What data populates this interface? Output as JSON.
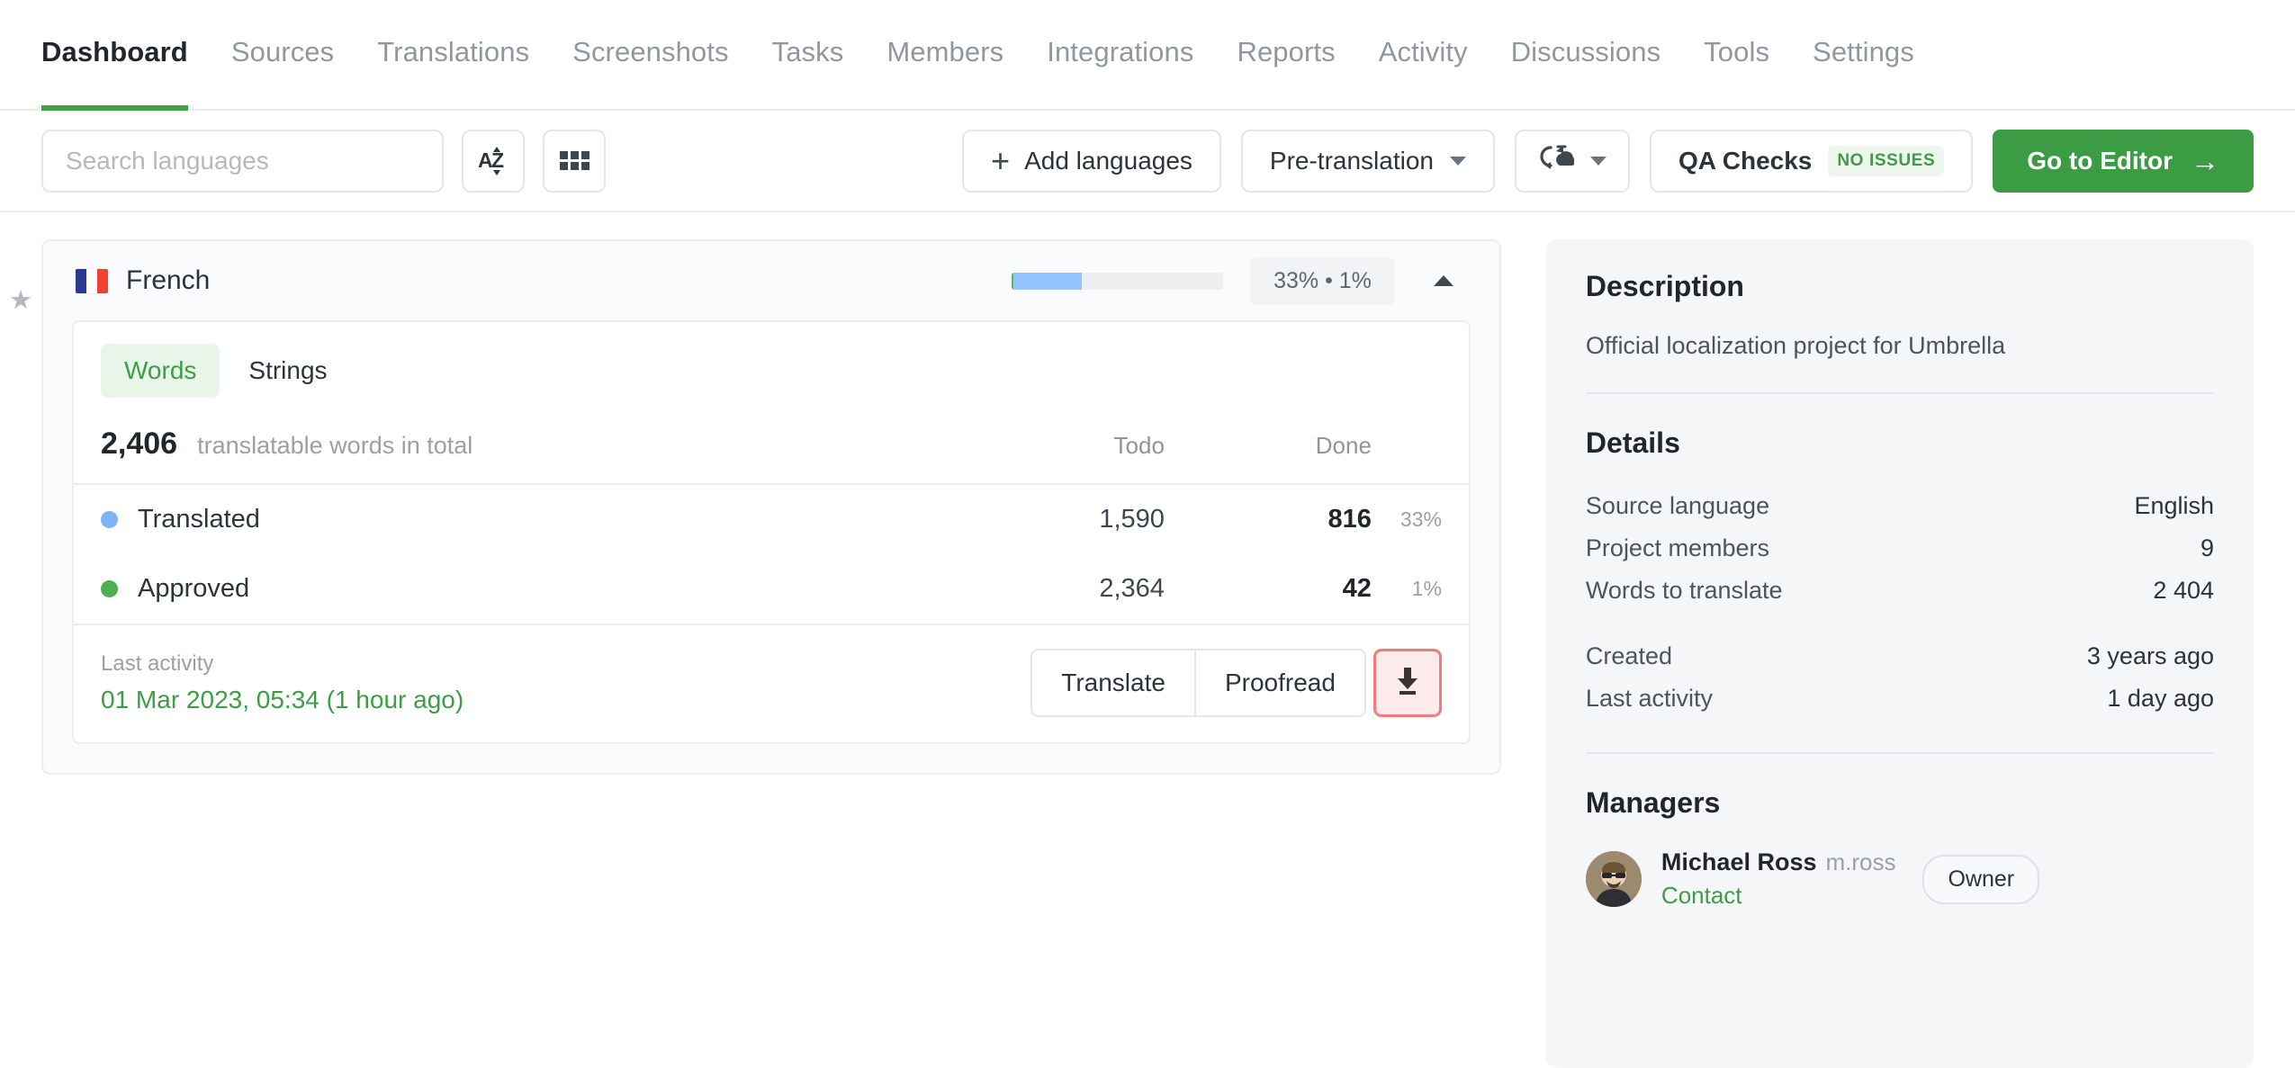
{
  "nav": {
    "items": [
      {
        "label": "Dashboard",
        "active": true
      },
      {
        "label": "Sources",
        "active": false
      },
      {
        "label": "Translations",
        "active": false
      },
      {
        "label": "Screenshots",
        "active": false
      },
      {
        "label": "Tasks",
        "active": false
      },
      {
        "label": "Members",
        "active": false
      },
      {
        "label": "Integrations",
        "active": false
      },
      {
        "label": "Reports",
        "active": false
      },
      {
        "label": "Activity",
        "active": false
      },
      {
        "label": "Discussions",
        "active": false
      },
      {
        "label": "Tools",
        "active": false
      },
      {
        "label": "Settings",
        "active": false
      }
    ]
  },
  "toolbar": {
    "search_placeholder": "Search languages",
    "search_value": "",
    "sort_icon": "sort-alpha-icon",
    "sort_icon_label": "AZ",
    "grid_icon": "grid-view-icon",
    "add_languages_label": "Add languages",
    "add_languages_icon": "plus-icon",
    "pretranslation_label": "Pre-translation",
    "pretranslation_caret": "chevron-down-icon",
    "sync_icon": "sync-cloud-icon",
    "sync_caret": "chevron-down-icon",
    "qa_checks_label": "QA Checks",
    "qa_checks_badge": "NO ISSUES",
    "go_to_editor_label": "Go to Editor",
    "go_to_editor_arrow": "→"
  },
  "language_card": {
    "star_icon": "star-icon",
    "flag_icon": "flag-france-icon",
    "flag_colors": [
      "#2b3a8f",
      "#ffffff",
      "#ef4135"
    ],
    "name": "French",
    "progress": {
      "approved_pct": 1,
      "translated_pct": 33,
      "approved_color": "#5cb85c",
      "translated_color": "#93c5fd",
      "track_color": "#eceef0"
    },
    "pct_badge": "33% • 1%",
    "collapse_icon": "chevron-up-icon",
    "tabs": [
      {
        "label": "Words",
        "active": true
      },
      {
        "label": "Strings",
        "active": false
      }
    ],
    "total_number": "2,406",
    "total_label": "translatable words in total",
    "col_todo": "Todo",
    "col_done": "Done",
    "stats": [
      {
        "name": "Translated",
        "dot": "blue",
        "todo": "1,590",
        "done": "816",
        "pct": "33%"
      },
      {
        "name": "Approved",
        "dot": "green",
        "todo": "2,364",
        "done": "42",
        "pct": "1%"
      }
    ],
    "last_activity_label": "Last activity",
    "last_activity_value": "01 Mar 2023, 05:34 (1 hour ago)",
    "translate_label": "Translate",
    "proofread_label": "Proofread",
    "download_icon": "download-icon"
  },
  "sidebar": {
    "description_title": "Description",
    "description_text": "Official localization project for Umbrella",
    "details_title": "Details",
    "details": [
      {
        "label": "Source language",
        "value": "English"
      },
      {
        "label": "Project members",
        "value": "9"
      },
      {
        "label": "Words to translate",
        "value": "2 404"
      }
    ],
    "details_secondary": [
      {
        "label": "Created",
        "value": "3 years ago"
      },
      {
        "label": "Last activity",
        "value": "1 day ago"
      }
    ],
    "managers_title": "Managers",
    "managers": [
      {
        "avatar_icon": "avatar",
        "name": "Michael Ross",
        "handle": "m.ross",
        "contact_label": "Contact",
        "role_badge": "Owner"
      }
    ]
  },
  "colors": {
    "accent_green": "#3b9c44",
    "tab_active_bg": "#e8f5e9",
    "highlight_border": "#ef7b7b",
    "highlight_bg": "#fdeaea"
  }
}
